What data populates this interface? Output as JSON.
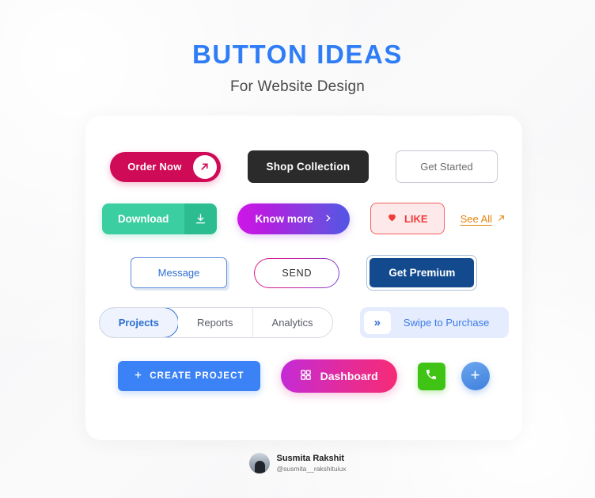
{
  "header": {
    "title": "BUTTON IDEAS",
    "subtitle": "For Website Design",
    "title_color": "#2f7df6"
  },
  "rows": {
    "row1": {
      "order_now": {
        "label": "Order Now",
        "icon": "arrow-up-right-icon",
        "color": "#cf0a57"
      },
      "shop_collection": {
        "label": "Shop Collection",
        "color": "#2b2b2b"
      },
      "get_started": {
        "label": "Get Started",
        "color": "#6d6d72"
      }
    },
    "row2": {
      "download": {
        "label": "Download",
        "icon": "download-icon",
        "color": "#3bcea0"
      },
      "know_more": {
        "label": "Know more",
        "icon": "chevron-right-icon",
        "color": "#b21fe0"
      },
      "like": {
        "label": "LIKE",
        "icon": "heart-icon",
        "color": "#f03b3b"
      },
      "see_all": {
        "label": "See All",
        "icon": "arrow-up-right-icon",
        "color": "#e2850f"
      }
    },
    "row3": {
      "message": {
        "label": "Message",
        "color": "#2f6fd0"
      },
      "send": {
        "label": "SEND",
        "color": "#c41fa0"
      },
      "get_premium": {
        "label": "Get Premium",
        "color": "#134a8e"
      }
    },
    "row4": {
      "segmented": {
        "tabs": [
          {
            "label": "Projects",
            "active": true
          },
          {
            "label": "Reports",
            "active": false
          },
          {
            "label": "Analytics",
            "active": false
          }
        ],
        "active_color": "#2f6fd0"
      },
      "swipe": {
        "label": "Swipe to Purchase",
        "icon": "double-chevron-right-icon",
        "color": "#3d7ce8"
      }
    },
    "row5": {
      "create_project": {
        "label": "CREATE PROJECT",
        "icon": "plus-icon",
        "color": "#3b82f6"
      },
      "dashboard": {
        "label": "Dashboard",
        "icon": "grid-icon",
        "color": "#e02ba0"
      },
      "phone": {
        "icon": "phone-icon",
        "color": "#3fc315"
      },
      "fab": {
        "icon": "plus-icon",
        "label": "+",
        "color": "#3f80dd"
      }
    }
  },
  "footer": {
    "name": "Susmita Rakshit",
    "handle": "@susmita__rakshituiux"
  }
}
